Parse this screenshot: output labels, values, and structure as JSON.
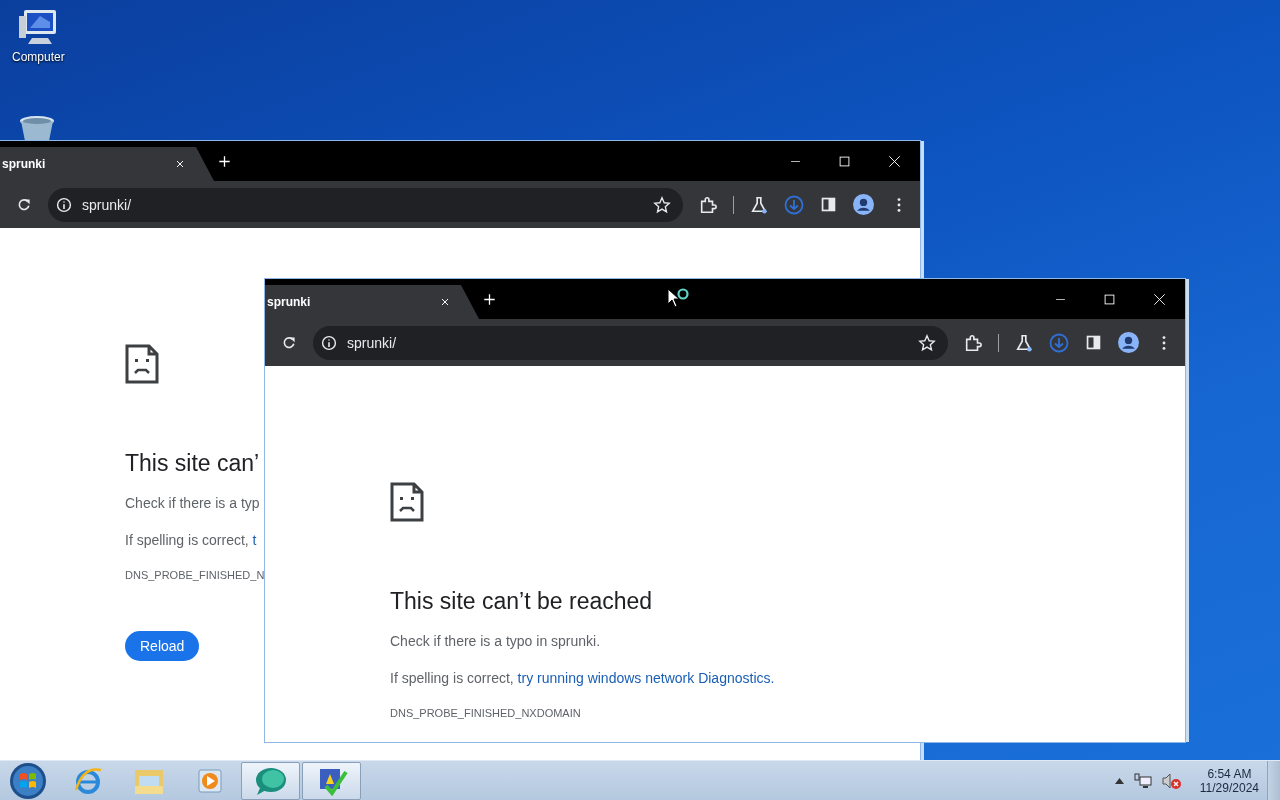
{
  "desktop_icons": [
    {
      "kind": "computer",
      "label": "Computer"
    },
    {
      "kind": "recycle-bin"
    }
  ],
  "windows": [
    {
      "tab_title": "sprunki",
      "url": "sprunki/",
      "error": {
        "heading": "This site can’",
        "paragraphs": [
          {
            "text": "Check if there is a typ"
          },
          {
            "text": "If spelling is correct, ",
            "link": "t"
          }
        ],
        "code": "DNS_PROBE_FINISHED_N",
        "button": "Reload"
      }
    },
    {
      "tab_title": "sprunki",
      "url": "sprunki/",
      "error": {
        "heading": "This site can’t be reached",
        "paragraphs": [
          {
            "text": "Check if there is a typo in sprunki."
          },
          {
            "text": "If spelling is correct, ",
            "link": "try running windows network Diagnostics."
          }
        ],
        "code": "DNS_PROBE_FINISHED_NXDOMAIN"
      }
    }
  ],
  "taskbar": {
    "items": [
      {
        "kind": "start"
      },
      {
        "kind": "browser",
        "running": false
      },
      {
        "kind": "folder",
        "running": false
      },
      {
        "kind": "media",
        "running": false
      },
      {
        "kind": "chat",
        "running": true
      },
      {
        "kind": "checklist",
        "running": true
      }
    ],
    "tray": [
      {
        "kind": "arrow"
      },
      {
        "kind": "network"
      },
      {
        "kind": "sound-muted"
      }
    ],
    "clock": {
      "time": "6:54 AM",
      "date": "11/29/2024"
    }
  }
}
